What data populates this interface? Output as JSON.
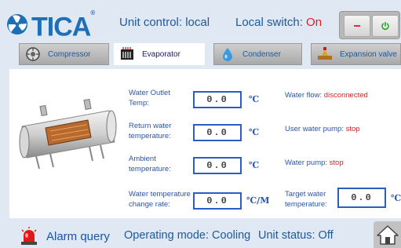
{
  "header": {
    "logo_text": "TICA",
    "unit_control": "Unit control: local",
    "local_switch_label": "Local switch: ",
    "local_switch_value": "On"
  },
  "tabs": [
    {
      "label": "Compressor",
      "icon": "compressor-icon",
      "active": false
    },
    {
      "label": "Evaporator",
      "icon": "evaporator-icon",
      "active": true
    },
    {
      "label": "Condenser",
      "icon": "droplet-icon",
      "active": false
    },
    {
      "label": "Expansion valve",
      "icon": "valve-icon",
      "active": false
    }
  ],
  "fields": [
    {
      "label": "Water Outlet Temp:",
      "value": "0.0",
      "unit": "℃"
    },
    {
      "label": "Return water temperature:",
      "value": "0.0",
      "unit": "℃"
    },
    {
      "label": "Ambient temperature:",
      "value": "0.0",
      "unit": "℃"
    },
    {
      "label": "Water temperature change rate:",
      "value": "0.0",
      "unit": "℃/M"
    }
  ],
  "status": [
    {
      "label": "Water flow: ",
      "value": "disconnected"
    },
    {
      "label": "User water pump: ",
      "value": "stop"
    },
    {
      "label": "Water pump: ",
      "value": "stop"
    }
  ],
  "target": {
    "label": "Target water temperature:",
    "value": "0.0",
    "unit": "℃"
  },
  "footer": {
    "alarm_label": "Alarm query",
    "operating_mode": "Operating mode: Cooling",
    "unit_status": "Unit status: Off"
  },
  "colors": {
    "accent_blue": "#1e5a9a",
    "alert_red": "#e02020",
    "field_border": "#2a5ec0"
  }
}
